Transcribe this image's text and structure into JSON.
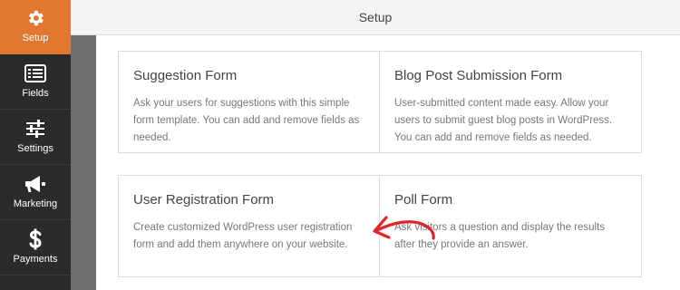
{
  "sidebar": {
    "items": [
      {
        "label": "Setup",
        "icon": "gear-icon",
        "active": true
      },
      {
        "label": "Fields",
        "icon": "fields-list-icon"
      },
      {
        "label": "Settings",
        "icon": "sliders-icon"
      },
      {
        "label": "Marketing",
        "icon": "megaphone-icon"
      },
      {
        "label": "Payments",
        "icon": "dollar-icon"
      }
    ]
  },
  "header": {
    "title": "Setup"
  },
  "templates": [
    {
      "title": "Suggestion Form",
      "description": "Ask your users for suggestions with this simple form template. You can add and remove fields as needed."
    },
    {
      "title": "Blog Post Submission Form",
      "description": "User-submitted content made easy. Allow your users to submit guest blog posts in WordPress. You can add and remove fields as needed."
    },
    {
      "title": "User Registration Form",
      "description": "Create customized WordPress user registration form and add them anywhere on your website."
    },
    {
      "title": "Poll Form",
      "description": "Ask visitors a question and display the results after they provide an answer."
    }
  ],
  "colors": {
    "accent": "#e27730",
    "sidebar": "#2b2b2b",
    "annotation_arrow": "#e0242a"
  }
}
